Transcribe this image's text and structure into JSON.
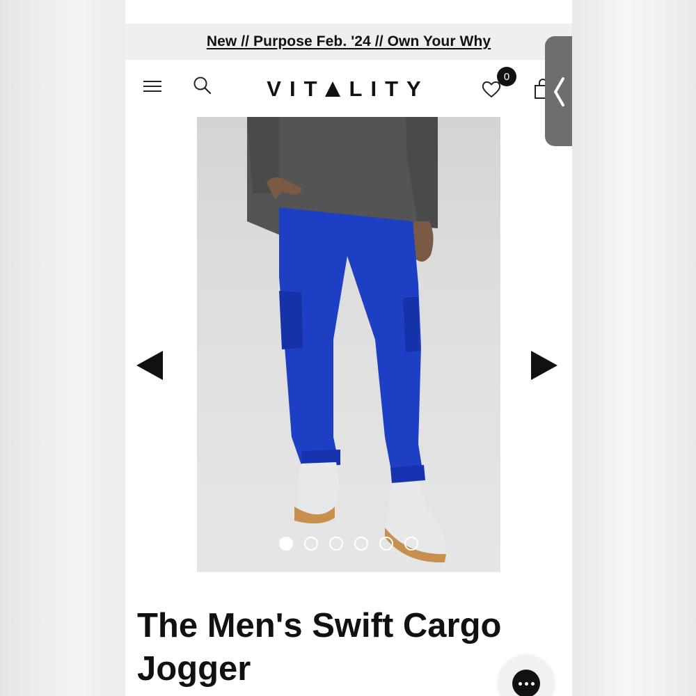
{
  "announcement": {
    "text": "New // Purpose Feb. '24 // Own Your Why"
  },
  "header": {
    "logo": "VITALITY",
    "logo_before": "VIT",
    "logo_after": "LITY",
    "wishlist_count": "0",
    "icons": [
      "menu-icon",
      "search-icon",
      "heart-icon",
      "shopping-bag-icon"
    ]
  },
  "gallery": {
    "image_alt": "The Men's Swift Cargo Jogger",
    "slide_count": 6,
    "active_slide": 1,
    "prev_icon": "triangle-left-icon",
    "next_icon": "triangle-right-icon"
  },
  "product": {
    "title": "The Men's Swift Cargo Jogger"
  },
  "side_tab": {
    "icon": "chevron-left-icon"
  },
  "chat": {
    "icon": "chat-dots-icon"
  },
  "colors": {
    "accent": "#111111",
    "announcement_bg": "#efefef",
    "product_blue": "#1c3fc4",
    "side_tab": "#6e6e6e"
  }
}
